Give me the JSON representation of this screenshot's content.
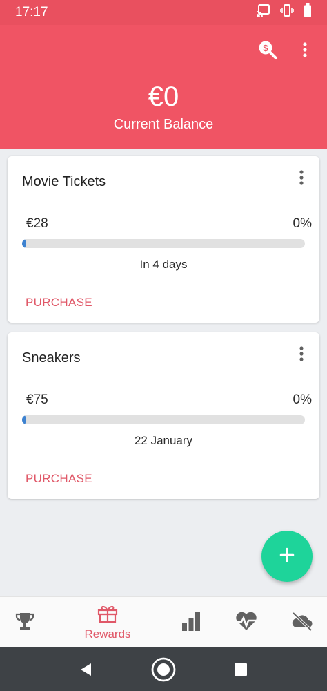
{
  "status_bar": {
    "time": "17:17",
    "icons": [
      "cast-icon",
      "vibrate-icon",
      "battery-icon"
    ]
  },
  "header": {
    "balance": "€0",
    "balance_label": "Current Balance",
    "actions": [
      "search-money-icon",
      "more-vert-icon"
    ],
    "color": "#f05464"
  },
  "rewards": [
    {
      "title": "Movie Tickets",
      "price": "€28",
      "percent": "0%",
      "progress": 0,
      "due": "In 4 days",
      "action": "PURCHASE"
    },
    {
      "title": "Sneakers",
      "price": "€75",
      "percent": "0%",
      "progress": 0,
      "due": "22 January",
      "action": "PURCHASE"
    }
  ],
  "fab": {
    "icon": "plus-icon",
    "color": "#1ed49a"
  },
  "bottom_nav": {
    "active": "Rewards",
    "items": [
      {
        "icon": "trophy-icon",
        "label": ""
      },
      {
        "icon": "gift-icon",
        "label": "Rewards"
      },
      {
        "icon": "bar-chart-icon",
        "label": ""
      },
      {
        "icon": "heartbeat-icon",
        "label": ""
      },
      {
        "icon": "cloud-off-icon",
        "label": ""
      }
    ]
  },
  "system_nav": [
    "back-icon",
    "home-icon",
    "recents-icon"
  ],
  "colors": {
    "accent": "#e05868",
    "progress": "#3d82d0"
  }
}
